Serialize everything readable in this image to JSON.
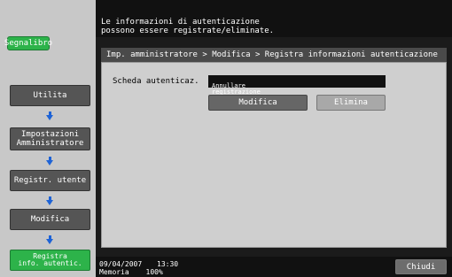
{
  "sidebar": {
    "bookmark_label": "Segnalibro",
    "items": [
      {
        "label": "Utilita"
      },
      {
        "label": "Impostazioni\nAmministratore"
      },
      {
        "label": "Registr. utente"
      },
      {
        "label": "Modifica"
      },
      {
        "label": "Registra\ninfo. autentic."
      }
    ]
  },
  "header": {
    "message": "Le informazioni di autenticazione\npossono essere registrate/eliminate."
  },
  "breadcrumb": {
    "text": "Imp. amministratore > Modifica > Registra informazioni autenticazione"
  },
  "main": {
    "field_label": "Scheda autenticaz.",
    "field_value": "Annullare\nregistrazione",
    "modify_label": "Modifica",
    "delete_label": "Elimina"
  },
  "status": {
    "date": "09/04/2007",
    "time": "13:30",
    "memory_label": "Memoria",
    "memory_value": "100%",
    "close_label": "Chiudi"
  },
  "colors": {
    "accent_green": "#2db34a",
    "arrow_blue": "#1e63d6"
  },
  "icons": {
    "down_arrow": "down-arrow-icon"
  }
}
